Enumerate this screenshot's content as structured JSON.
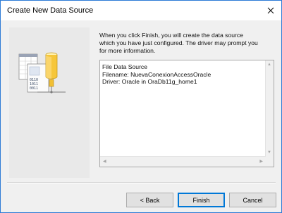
{
  "window": {
    "title": "Create New Data Source"
  },
  "intro": {
    "lines": [
      "When you click Finish, you will create the data source",
      "which you have just configured.  The driver may prompt you",
      "for more information."
    ]
  },
  "summary": {
    "lines": [
      "File Data Source",
      "Filename:  NuevaConexionAccessOracle",
      "Driver:  Oracle in OraDb11g_home1"
    ]
  },
  "buttons": {
    "back": "< Back",
    "finish": "Finish",
    "cancel": "Cancel"
  },
  "icons": {
    "close": "close-icon",
    "wizard_art": "data-source-wizard-illustration",
    "scroll_up": "scroll-up-arrow-icon",
    "scroll_down": "scroll-down-arrow-icon",
    "scroll_left": "scroll-left-arrow-icon",
    "scroll_right": "scroll-right-arrow-icon"
  },
  "colors": {
    "window_border": "#2d7bd6",
    "dialog_bg": "#f0f0f0",
    "default_button_border": "#0078d7"
  }
}
